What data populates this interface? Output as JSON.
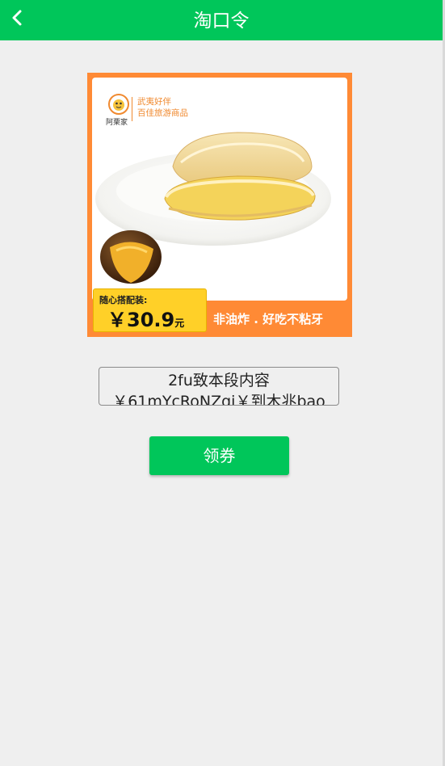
{
  "header": {
    "title": "淘口令"
  },
  "product": {
    "brand_name": "阿栗家",
    "slogan_line1": "武夷好伴",
    "slogan_line2": "百佳旅游商品",
    "price_label": "随心搭配装:",
    "price_value": "￥30.9",
    "price_unit": "元",
    "tagline": "非油炸 . 好吃不粘牙"
  },
  "code": {
    "text": "2fu致本段内容￥61mYcRoNZqi￥到木兆bao"
  },
  "actions": {
    "coupon_label": "领券"
  },
  "colors": {
    "accent": "#00c65a",
    "card_border": "#ff8a35",
    "price_badge": "#ffd028"
  }
}
